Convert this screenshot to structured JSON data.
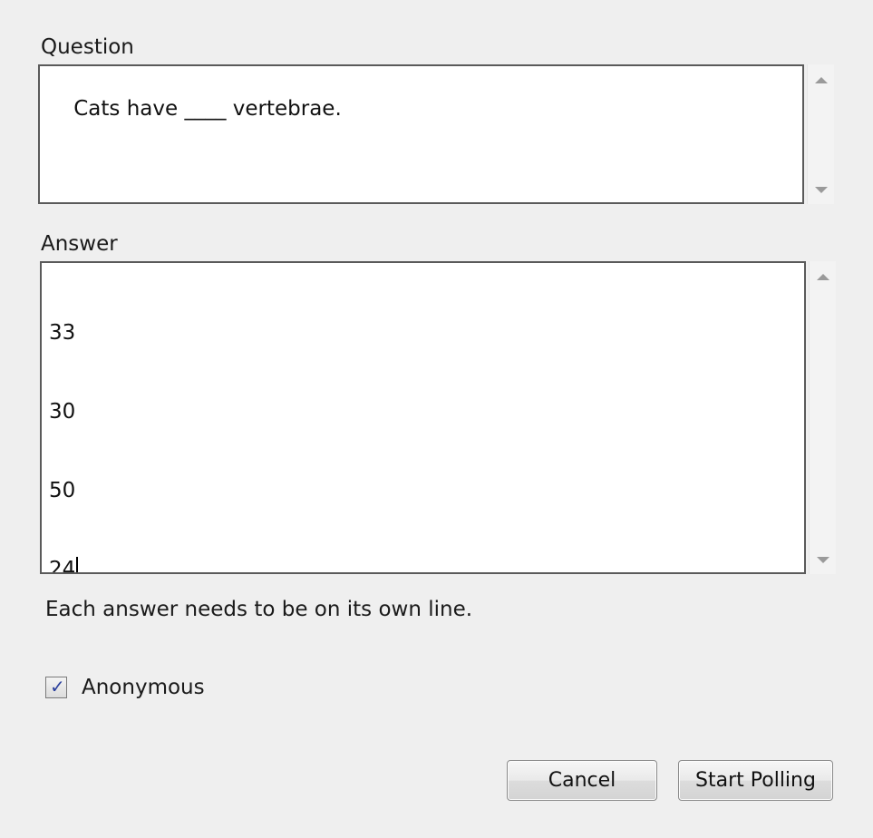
{
  "question": {
    "label": "Question",
    "value": "Cats have ____ vertebrae."
  },
  "answer": {
    "label": "Answer",
    "lines": [
      "33",
      "30",
      "50",
      "24"
    ]
  },
  "hint": "Each answer needs to be on its own line.",
  "anonymous": {
    "label": "Anonymous",
    "checked": true
  },
  "buttons": {
    "cancel": "Cancel",
    "start": "Start Polling"
  }
}
